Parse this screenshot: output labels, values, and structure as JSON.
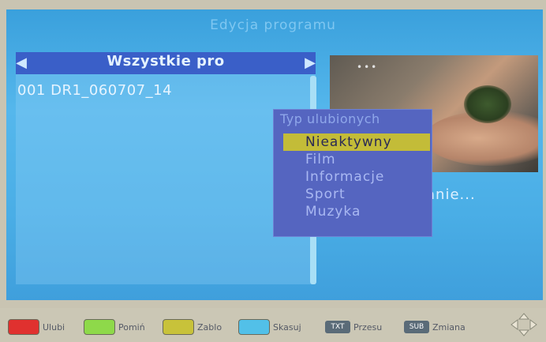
{
  "screen": {
    "title": "Edycja programu",
    "list_header": "Wszystkie pro",
    "channels": [
      {
        "label": "001 DR1_060707_14"
      }
    ],
    "status_text": "anie...",
    "preview_dots": "•••"
  },
  "favorites_popup": {
    "title": "Typ ulubionych",
    "items": [
      {
        "label": "Nieaktywny",
        "selected": true
      },
      {
        "label": "Film"
      },
      {
        "label": "Informacje"
      },
      {
        "label": "Sport"
      },
      {
        "label": "Muzyka"
      }
    ]
  },
  "bottom_bar": {
    "buttons": [
      {
        "label": "Ulubi",
        "color": "#e0312f"
      },
      {
        "label": "Pomiń",
        "color": "#8ed94a"
      },
      {
        "label": "Zablo",
        "color": "#c8c23a"
      },
      {
        "label": "Skasuj",
        "color": "#52c0e8"
      },
      {
        "label": "Przesu",
        "chip": "TXT"
      },
      {
        "label": "Zmiana",
        "chip": "SUB"
      }
    ],
    "nav_icon": "direction-pad-icon"
  },
  "colors": {
    "screen_blue": "#4aaee6",
    "header_blue": "#3a5fc8",
    "popup_blue": "#5565c0",
    "selection_yellow": "#c3bc38"
  }
}
